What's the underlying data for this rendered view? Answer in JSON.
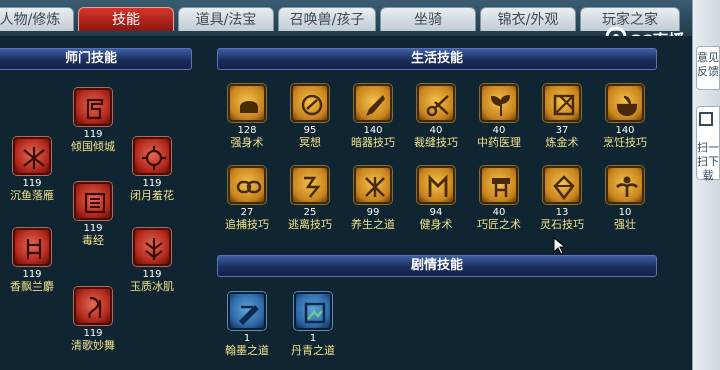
{
  "tabs": [
    {
      "label": "人物/修炼",
      "active": false
    },
    {
      "label": "技能",
      "active": true
    },
    {
      "label": "道具/法宝",
      "active": false
    },
    {
      "label": "召唤兽/孩子",
      "active": false
    },
    {
      "label": "坐骑",
      "active": false
    },
    {
      "label": "锦衣/外观",
      "active": false
    },
    {
      "label": "玩家之家",
      "active": false
    }
  ],
  "sections": {
    "school": "师门技能",
    "life": "生活技能",
    "story": "剧情技能"
  },
  "school_skills": [
    {
      "level": "119",
      "name": "倾国倾城",
      "icon": "red-glyph-icon"
    },
    {
      "level": "119",
      "name": "沉鱼落雁",
      "icon": "red-glyph-icon"
    },
    {
      "level": "119",
      "name": "闭月羞花",
      "icon": "red-glyph-icon"
    },
    {
      "level": "119",
      "name": "毒经",
      "icon": "red-glyph-icon"
    },
    {
      "level": "119",
      "name": "香飘兰麝",
      "icon": "red-glyph-icon"
    },
    {
      "level": "119",
      "name": "玉质冰肌",
      "icon": "red-glyph-icon"
    },
    {
      "level": "119",
      "name": "清歌妙舞",
      "icon": "red-glyph-icon"
    }
  ],
  "life_skills": [
    {
      "level": "128",
      "name": "强身术"
    },
    {
      "level": "95",
      "name": "冥想"
    },
    {
      "level": "140",
      "name": "暗器技巧"
    },
    {
      "level": "40",
      "name": "裁缝技巧"
    },
    {
      "level": "40",
      "name": "中药医理"
    },
    {
      "level": "37",
      "name": "炼金术"
    },
    {
      "level": "140",
      "name": "烹饪技巧"
    },
    {
      "level": "27",
      "name": "追捕技巧"
    },
    {
      "level": "25",
      "name": "逃离技巧"
    },
    {
      "level": "99",
      "name": "养生之道"
    },
    {
      "level": "94",
      "name": "健身术"
    },
    {
      "level": "40",
      "name": "巧匠之术"
    },
    {
      "level": "13",
      "name": "灵石技巧"
    },
    {
      "level": "10",
      "name": "强壮"
    }
  ],
  "story_skills": [
    {
      "level": "1",
      "name": "翰墨之道"
    },
    {
      "level": "1",
      "name": "丹青之道"
    }
  ],
  "sidebar": {
    "tab1": "意见反馈",
    "tab2": "扫一扫下载"
  },
  "logo": "CC直播",
  "colors": {
    "active_tab": "#b8241a",
    "name_text": "#f3e08a",
    "panel_bg": "#0f2632"
  }
}
